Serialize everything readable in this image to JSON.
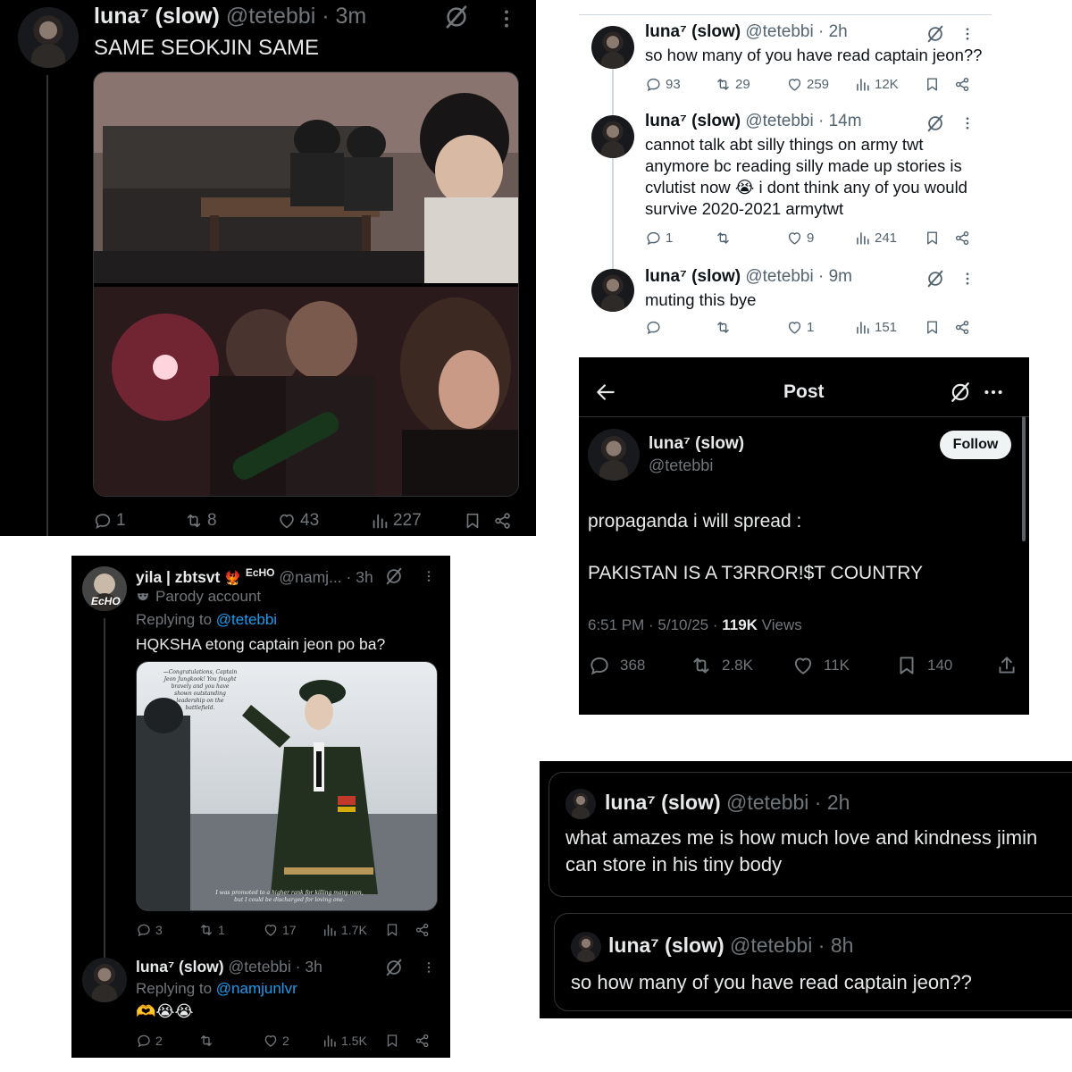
{
  "tweet1": {
    "name": "luna⁷ (slow)",
    "handle": "@tetebbi",
    "time": "· 3m",
    "text": "SAME SEOKJIN SAME",
    "actions": {
      "replies": "1",
      "reposts": "8",
      "likes": "43",
      "views": "227"
    }
  },
  "thread": [
    {
      "name": "luna⁷ (slow)",
      "handle": "@tetebbi",
      "time": "· 2h",
      "lines": [
        "so how many of you have read captain jeon??"
      ],
      "actions": {
        "replies": "93",
        "reposts": "29",
        "likes": "259",
        "views": "12K"
      }
    },
    {
      "name": "luna⁷ (slow)",
      "handle": "@tetebbi",
      "time": "· 14m",
      "lines": [
        "cannot talk abt silly things on army twt",
        "anymore bc reading silly made up stories is",
        "cvlutist now 😭 i dont think any of you would",
        "survive 2020-2021 armytwt"
      ],
      "actions": {
        "replies": "1",
        "reposts": "",
        "likes": "9",
        "views": "241"
      }
    },
    {
      "name": "luna⁷ (slow)",
      "handle": "@tetebbi",
      "time": "· 9m",
      "lines": [
        "muting this bye"
      ],
      "actions": {
        "replies": "",
        "reposts": "",
        "likes": "1",
        "views": "151"
      }
    }
  ],
  "post": {
    "header_title": "Post",
    "name": "luna⁷ (slow)",
    "handle": "@tetebbi",
    "follow_label": "Follow",
    "line1": "propaganda i will spread :",
    "line2": "PAKISTAN IS A T3RROR!$T COUNTRY",
    "meta_time": "6:51 PM · 5/10/25 · ",
    "meta_views_num": "119K",
    "meta_views_label": " Views",
    "actions": {
      "replies": "368",
      "reposts": "2.8K",
      "likes": "11K",
      "bookmarks": "140"
    }
  },
  "reply_panel": {
    "reply1": {
      "name": "yila | zbtsvt",
      "badge": "EcHO",
      "handle": "@namj...",
      "time": "· 3h",
      "parody_label": "Parody account",
      "replying_prefix": "Replying to ",
      "replying_to": "@tetebbi",
      "text": "HQKSHA etong captain jeon po ba?",
      "image_caption_top": "—Congratulations, Captain Jeon Jungkook! You fought bravely and you have shown outstanding leadership on the battlefield.",
      "image_caption_bottom": "I was promoted to a higher rank for killing many men, but I could be discharged for loving one.",
      "actions": {
        "replies": "3",
        "reposts": "1",
        "likes": "17",
        "views": "1.7K"
      }
    },
    "reply2": {
      "name": "luna⁷ (slow)",
      "handle": "@tetebbi",
      "time": "· 3h",
      "replying_prefix": "Replying to ",
      "replying_to": "@namjunlvr",
      "text": "🫶😭😭",
      "actions": {
        "replies": "2",
        "reposts": "",
        "likes": "2",
        "views": "1.5K"
      }
    }
  },
  "cards": [
    {
      "name": "luna⁷ (slow)",
      "handle": "@tetebbi",
      "time": "· 2h",
      "lines": [
        "what amazes me is how much love and kindness jimin",
        "can store in his tiny body"
      ]
    },
    {
      "name": "luna⁷ (slow)",
      "handle": "@tetebbi",
      "time": "· 8h",
      "lines": [
        "so how many of you have read captain jeon??"
      ]
    }
  ],
  "colors": {
    "link": "#1d9bf0",
    "muted_dark": "#71767b",
    "muted_light": "#536471"
  }
}
